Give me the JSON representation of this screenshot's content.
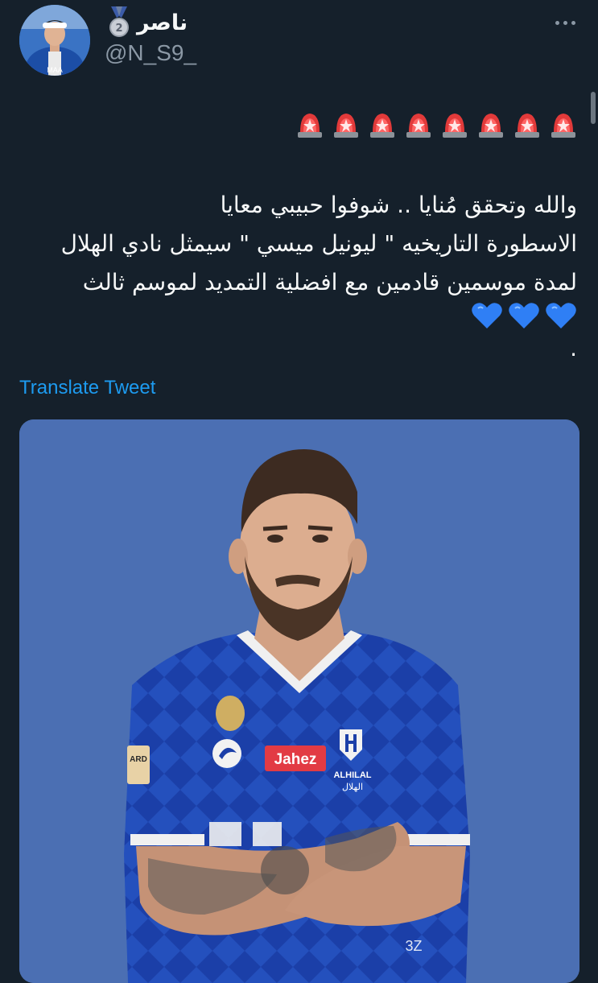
{
  "author": {
    "display_name": "ناصر",
    "handle": "@N_S9_",
    "badge_icon": "2nd-place-medal-icon"
  },
  "tweet": {
    "emoji_row_icon": "police-car-light-icon",
    "emoji_row_count": 8,
    "lines": [
      "والله وتحقق مُنايا .. شوفوا حبيبي معايا",
      "الاسطورة التاريخيه \" ليونيل ميسي \" سيمثل نادي الهلال",
      "لمدة موسمين قادمين مع افضلية التمديد لموسم ثالث"
    ],
    "hearts_icon": "blue-heart-icon",
    "hearts_count": 3,
    "trailing_text": "."
  },
  "translate_label": "Translate Tweet",
  "media": {
    "jersey_sponsor": "Jahez",
    "club_name_en": "ALHILAL",
    "club_name_ar": "الهلال",
    "side_label": "ARD",
    "number_label": "3Z"
  },
  "colors": {
    "background": "#15202b",
    "text": "#f7f9f9",
    "secondary_text": "#8b98a5",
    "link": "#1d9bf0",
    "media_bg": "#4b6fb3",
    "jersey": "#1b3fa8"
  }
}
